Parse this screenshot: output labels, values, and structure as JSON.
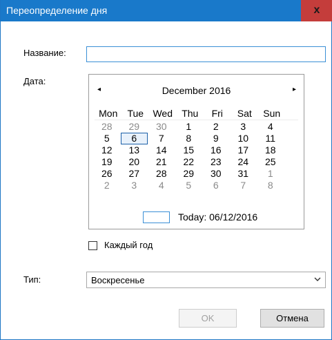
{
  "window": {
    "title": "Переопределение дня",
    "close_glyph": "x"
  },
  "form": {
    "name_label": "Название:",
    "name_value": "",
    "date_label": "Дата:",
    "type_label": "Тип:",
    "type_value": "Воскресенье",
    "yearly_label": "Каждый год",
    "yearly_checked": false
  },
  "calendar": {
    "month": "December 2016",
    "prev_glyph": "◂",
    "next_glyph": "▸",
    "weekdays": [
      "Mon",
      "Tue",
      "Wed",
      "Thu",
      "Fri",
      "Sat",
      "Sun"
    ],
    "weeks": [
      [
        "28",
        "29",
        "30",
        "1",
        "2",
        "3",
        "4"
      ],
      [
        "5",
        "6",
        "7",
        "8",
        "9",
        "10",
        "11"
      ],
      [
        "12",
        "13",
        "14",
        "15",
        "16",
        "17",
        "18"
      ],
      [
        "19",
        "20",
        "21",
        "22",
        "23",
        "24",
        "25"
      ],
      [
        "26",
        "27",
        "28",
        "29",
        "30",
        "31",
        "1"
      ],
      [
        "2",
        "3",
        "4",
        "5",
        "6",
        "7",
        "8"
      ]
    ],
    "other_month": [
      [
        true,
        true,
        true,
        false,
        false,
        false,
        false
      ],
      [
        false,
        false,
        false,
        false,
        false,
        false,
        false
      ],
      [
        false,
        false,
        false,
        false,
        false,
        false,
        false
      ],
      [
        false,
        false,
        false,
        false,
        false,
        false,
        false
      ],
      [
        false,
        false,
        false,
        false,
        false,
        false,
        true
      ],
      [
        true,
        true,
        true,
        true,
        true,
        true,
        true
      ]
    ],
    "selected": "6",
    "today_text": "Today: 06/12/2016"
  },
  "buttons": {
    "ok": "OK",
    "cancel": "Отмена"
  },
  "colors": {
    "titlebar": "#1979ca",
    "close": "#c43d3b",
    "accent": "#3a8fd6"
  }
}
